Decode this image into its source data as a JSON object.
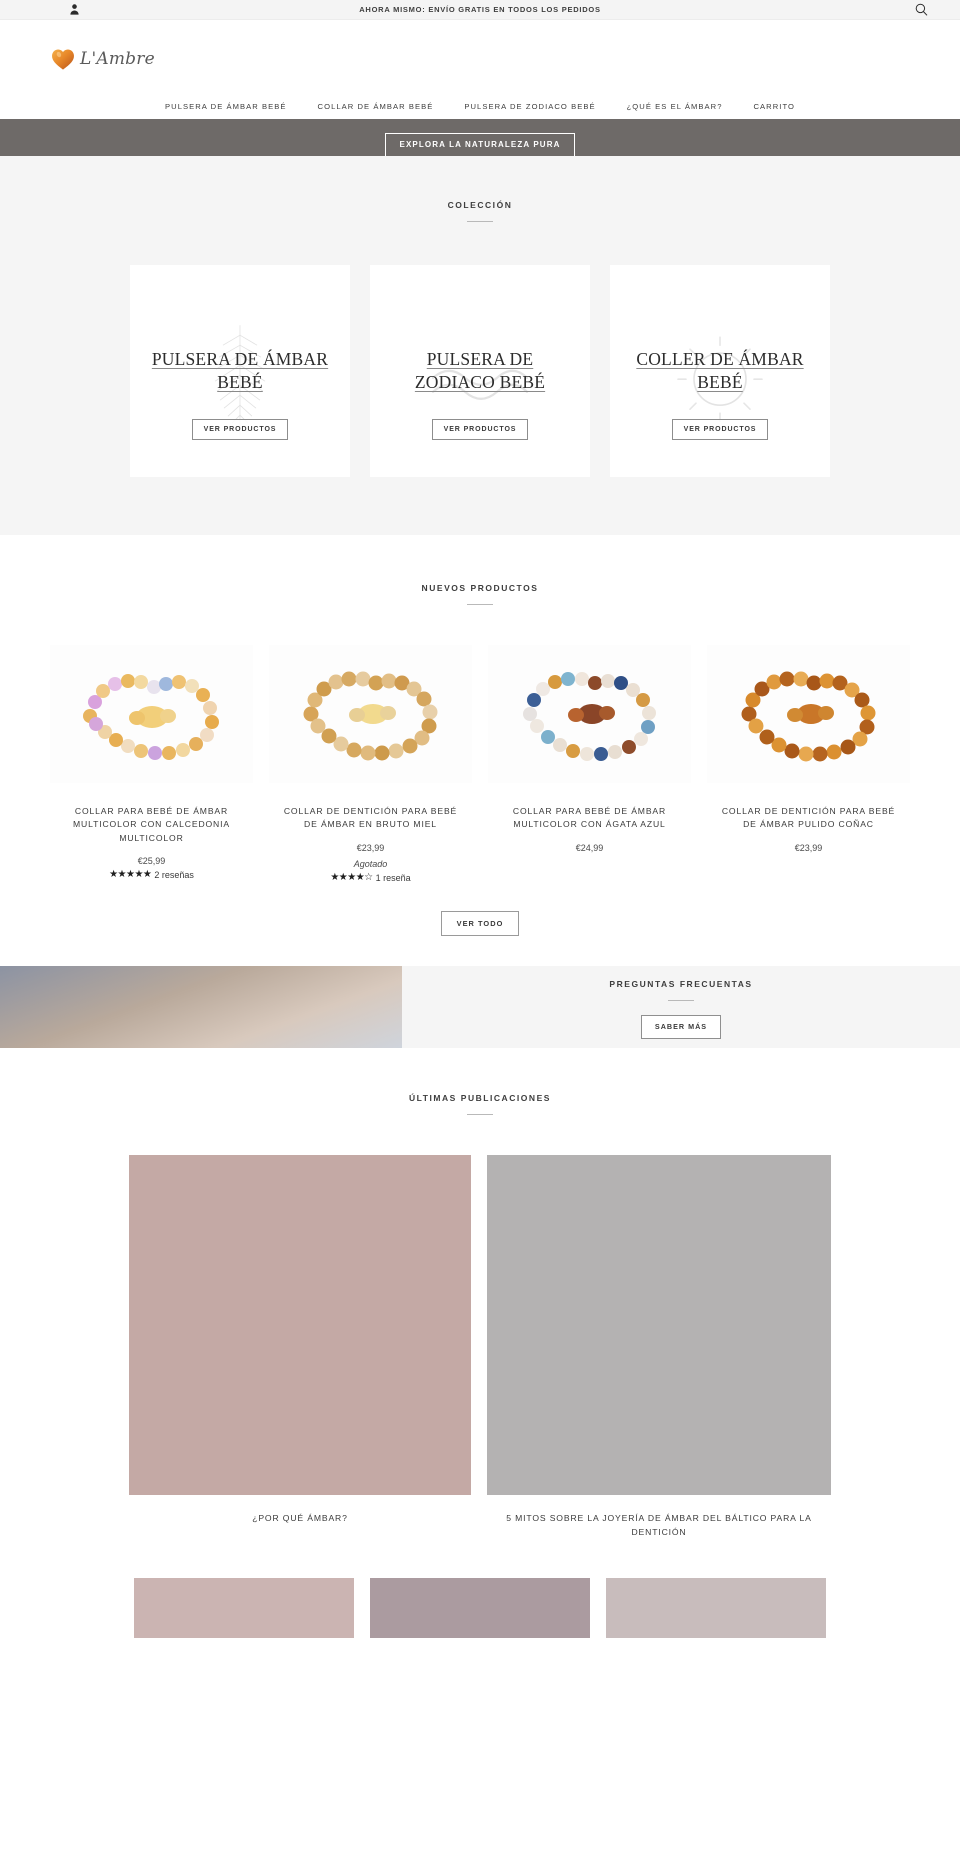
{
  "announcement": {
    "text": "AHORA MISMO: ENVÍO GRATIS EN TODOS LOS PEDIDOS",
    "account_icon": "account-icon",
    "search_icon": "search-icon"
  },
  "brand": {
    "name": "L'Ambre",
    "logo_icon": "heart-amber-logo"
  },
  "nav": {
    "items": [
      {
        "label": "PULSERA DE ÁMBAR BEBÉ"
      },
      {
        "label": "COLLAR DE ÁMBAR BEBÉ"
      },
      {
        "label": "PULSERA DE ZODIACO BEBÉ"
      },
      {
        "label": "¿QUÉ ES EL ÁMBAR?"
      },
      {
        "label": "CARRITO"
      }
    ]
  },
  "hero": {
    "cta_label": "EXPLORA LA NATURALEZA PURA"
  },
  "collection": {
    "heading": "COLECCIÓN",
    "cards": [
      {
        "title": "PULSERA DE ÁMBAR BEBÉ",
        "button": "VER PRODUCTOS",
        "art": "fern-leaf"
      },
      {
        "title": "PULSERA DE ZODIACO BEBÉ",
        "button": "VER PRODUCTOS",
        "art": "waves"
      },
      {
        "title": "COLLER DE ÁMBAR BEBÉ",
        "button": "VER PRODUCTOS",
        "art": "sun-circle"
      }
    ]
  },
  "products": {
    "heading": "NUEVOS PRODUCTOS",
    "view_all_label": "VER TODO",
    "items": [
      {
        "title": "COLLAR PARA BEBÉ DE ÁMBAR MULTICOLOR CON CALCEDONIA MULTICOLOR",
        "price": "€25,99",
        "stars": "★★★★★",
        "reviews": "2 reseñas",
        "sold_out": ""
      },
      {
        "title": "COLLAR DE DENTICIÓN PARA BEBÉ DE ÁMBAR EN BRUTO MIEL",
        "price": "€23,99",
        "stars": "★★★★☆",
        "reviews": "1 reseña",
        "sold_out": "Agotado"
      },
      {
        "title": "COLLAR PARA BEBÉ DE ÁMBAR MULTICOLOR CON ÁGATA AZUL",
        "price": "€24,99",
        "stars": "",
        "reviews": "",
        "sold_out": ""
      },
      {
        "title": "COLLAR DE DENTICIÓN PARA BEBÉ DE ÁMBAR PULIDO COÑAC",
        "price": "€23,99",
        "stars": "",
        "reviews": "",
        "sold_out": ""
      }
    ]
  },
  "faq": {
    "heading": "PREGUNTAS FRECUENTAS",
    "button": "SABER MÁS"
  },
  "blog": {
    "heading": "ÚLTIMAS PUBLICACIONES",
    "posts": [
      {
        "title": "¿POR QUÉ ÁMBAR?"
      },
      {
        "title": "5 MITOS SOBRE LA JOYERÍA DE ÁMBAR DEL BÁLTICO PARA LA DENTICIÓN"
      }
    ]
  },
  "colors": {
    "hero_bar": "#6e6a68",
    "section_bg": "#f5f5f5",
    "text": "#3c3c3c",
    "amber": "#e08a2e"
  }
}
